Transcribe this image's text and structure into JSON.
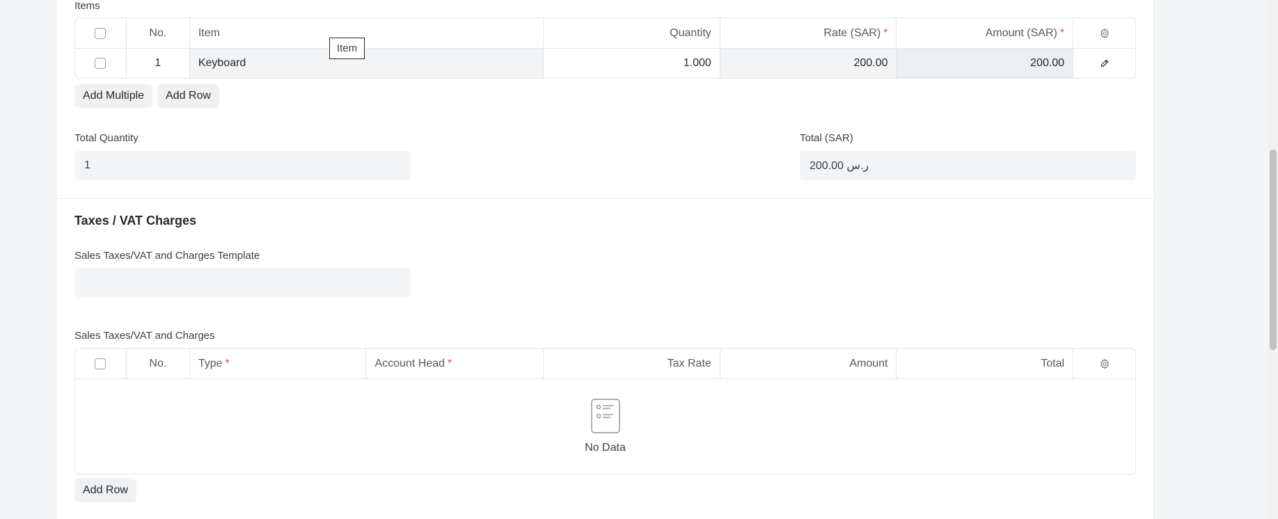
{
  "items_section": {
    "label": "Items",
    "columns": {
      "no": "No.",
      "item": "Item",
      "quantity": "Quantity",
      "rate": "Rate (SAR)",
      "amount": "Amount (SAR)"
    },
    "rows": [
      {
        "no": "1",
        "item": "Keyboard",
        "quantity": "1.000",
        "rate": "200.00",
        "amount": "200.00"
      }
    ],
    "tooltip": "Item",
    "add_multiple_label": "Add Multiple",
    "add_row_label": "Add Row"
  },
  "totals": {
    "total_quantity_label": "Total Quantity",
    "total_quantity_value": "1",
    "total_label": "Total (SAR)",
    "total_value": "ر.س 200.00"
  },
  "taxes_section": {
    "title": "Taxes / VAT Charges",
    "template_label": "Sales Taxes/VAT and Charges Template",
    "template_value": "",
    "charges_label": "Sales Taxes/VAT and Charges",
    "columns": {
      "no": "No.",
      "type": "Type",
      "account_head": "Account Head",
      "tax_rate": "Tax Rate",
      "amount": "Amount",
      "total": "Total"
    },
    "empty_text": "No Data",
    "add_row_label": "Add Row"
  },
  "colors": {
    "required": "#e24c4c",
    "field_bg": "#f3f4f5"
  },
  "icons": {
    "settings": "gear-icon",
    "edit": "pencil-icon",
    "empty": "empty-list-icon"
  }
}
